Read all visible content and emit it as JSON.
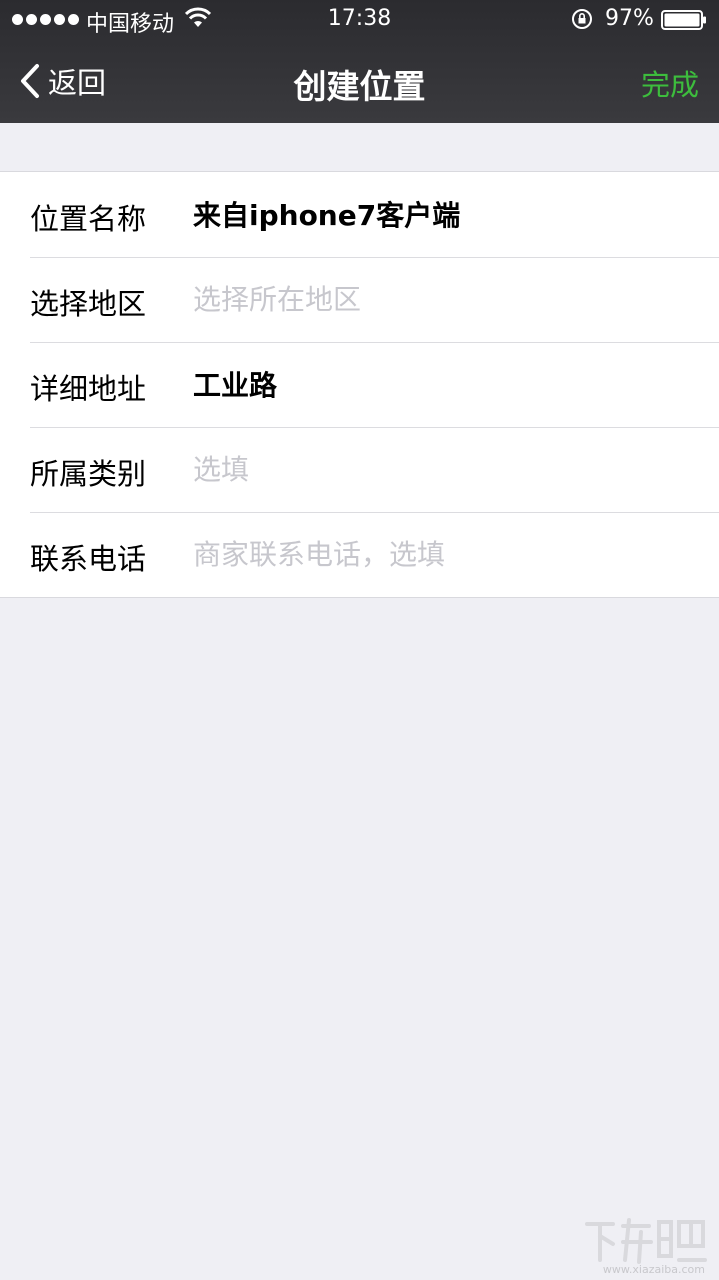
{
  "status_bar": {
    "carrier": "中国移动",
    "time": "17:38",
    "battery": "97%"
  },
  "nav": {
    "back_label": "返回",
    "title": "创建位置",
    "done_label": "完成"
  },
  "form": {
    "rows": [
      {
        "label": "位置名称",
        "value": "来自iphone7客户端",
        "placeholder": ""
      },
      {
        "label": "选择地区",
        "value": "",
        "placeholder": "选择所在地区"
      },
      {
        "label": "详细地址",
        "value": "工业路",
        "placeholder": ""
      },
      {
        "label": "所属类别",
        "value": "",
        "placeholder": "选填"
      },
      {
        "label": "联系电话",
        "value": "",
        "placeholder": "商家联系电话，选填"
      }
    ]
  },
  "watermark": "www.xiazaiba.com",
  "colors": {
    "accent": "#3dbd3d",
    "navbar": "#333337",
    "background": "#efeff4"
  }
}
